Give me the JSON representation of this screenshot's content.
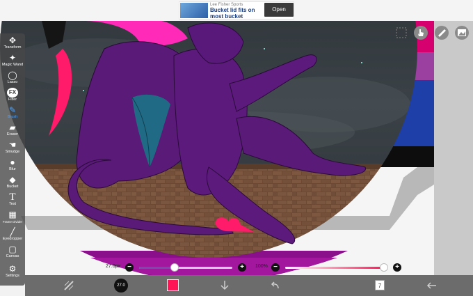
{
  "ad": {
    "sponsor": "Lee Fisher Sports",
    "title": "Bucket lid fits on most bucket",
    "button": "Open"
  },
  "toolbar": {
    "tools": [
      {
        "label": "Transform",
        "icon": "move-icon"
      },
      {
        "label": "Magic Wand",
        "icon": "magic-wand-icon"
      },
      {
        "label": "Lasso",
        "icon": "lasso-icon"
      },
      {
        "label": "Filter",
        "icon": "fx-icon"
      },
      {
        "label": "Brush",
        "icon": "brush-icon",
        "active": true
      },
      {
        "label": "Eraser",
        "icon": "eraser-icon"
      },
      {
        "label": "Smudge",
        "icon": "smudge-icon"
      },
      {
        "label": "Blur",
        "icon": "blur-drop-icon"
      },
      {
        "label": "Bucket",
        "icon": "bucket-icon"
      },
      {
        "label": "Text",
        "icon": "text-icon"
      },
      {
        "label": "Frame Divider",
        "icon": "frame-divider-icon"
      },
      {
        "label": "Eyedropper",
        "icon": "eyedropper-icon"
      },
      {
        "label": "Canvas",
        "icon": "canvas-icon"
      },
      {
        "label": "Settings",
        "icon": "gear-icon"
      }
    ]
  },
  "sliders": {
    "size_value": "27.0px",
    "size_fraction": 0.38,
    "opacity_value": "100%",
    "opacity_fraction": 1.0
  },
  "bottombar": {
    "brush_size_label": "27.0",
    "layer_count": "7"
  },
  "colors": {
    "current_color": "#ff1455",
    "toolbar_active": "#4da3ff",
    "flag_pink": "#d6006f",
    "flag_purple": "#9b3fa0",
    "flag_blue": "#1f3fa8",
    "creature_purple": "#5a1a78"
  }
}
